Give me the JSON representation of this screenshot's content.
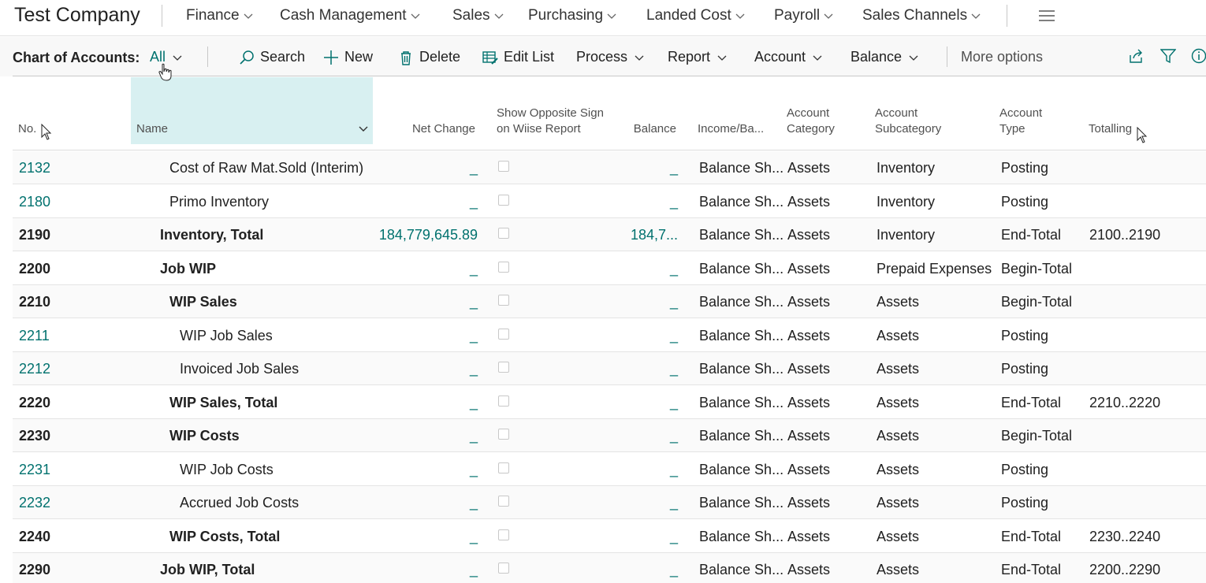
{
  "app": {
    "company": "Test Company",
    "nav": [
      "Finance",
      "Cash Management",
      "Sales",
      "Purchasing",
      "Landed Cost",
      "Payroll",
      "Sales Channels"
    ]
  },
  "actionbar": {
    "title": "Chart of Accounts:",
    "view": "All",
    "search": "Search",
    "new": "New",
    "delete": "Delete",
    "edit_list": "Edit List",
    "process": "Process",
    "report": "Report",
    "account": "Account",
    "balance": "Balance",
    "more_options": "More options"
  },
  "columns": {
    "no": "No.",
    "name": "Name",
    "net_change": "Net Change",
    "opp_sign_1": "Show Opposite Sign",
    "opp_sign_2": "on Wiise Report",
    "balance": "Balance",
    "income_balance": "Income/Ba...",
    "category_1": "Account",
    "category_2": "Category",
    "subcategory_1": "Account",
    "subcategory_2": "Subcategory",
    "type_1": "Account",
    "type_2": "Type",
    "totalling": "Totalling"
  },
  "rows": [
    {
      "no": "2132",
      "name": "Cost of Raw Mat.Sold (Interim)",
      "indent": 2,
      "bold": false,
      "net_change": "_",
      "balance": "_",
      "ib": "Balance Sh...",
      "cat": "Assets",
      "subcat": "Inventory",
      "type": "Posting",
      "totalling": ""
    },
    {
      "no": "2180",
      "name": "Primo Inventory",
      "indent": 2,
      "bold": false,
      "net_change": "_",
      "balance": "_",
      "ib": "Balance Sh...",
      "cat": "Assets",
      "subcat": "Inventory",
      "type": "Posting",
      "totalling": ""
    },
    {
      "no": "2190",
      "name": "Inventory, Total",
      "indent": 1,
      "bold": true,
      "net_change": "184,779,645.89",
      "balance": "184,7...",
      "ib": "Balance Sh...",
      "cat": "Assets",
      "subcat": "Inventory",
      "type": "End-Total",
      "totalling": "2100..2190"
    },
    {
      "no": "2200",
      "name": "Job WIP",
      "indent": 1,
      "bold": true,
      "net_change": "_",
      "balance": "_",
      "ib": "Balance Sh...",
      "cat": "Assets",
      "subcat": "Prepaid Expenses",
      "type": "Begin-Total",
      "totalling": ""
    },
    {
      "no": "2210",
      "name": "WIP Sales",
      "indent": 2,
      "bold": true,
      "net_change": "_",
      "balance": "_",
      "ib": "Balance Sh...",
      "cat": "Assets",
      "subcat": "Assets",
      "type": "Begin-Total",
      "totalling": ""
    },
    {
      "no": "2211",
      "name": "WIP Job Sales",
      "indent": 3,
      "bold": false,
      "net_change": "_",
      "balance": "_",
      "ib": "Balance Sh...",
      "cat": "Assets",
      "subcat": "Assets",
      "type": "Posting",
      "totalling": ""
    },
    {
      "no": "2212",
      "name": "Invoiced Job Sales",
      "indent": 3,
      "bold": false,
      "net_change": "_",
      "balance": "_",
      "ib": "Balance Sh...",
      "cat": "Assets",
      "subcat": "Assets",
      "type": "Posting",
      "totalling": ""
    },
    {
      "no": "2220",
      "name": "WIP Sales, Total",
      "indent": 2,
      "bold": true,
      "net_change": "_",
      "balance": "_",
      "ib": "Balance Sh...",
      "cat": "Assets",
      "subcat": "Assets",
      "type": "End-Total",
      "totalling": "2210..2220"
    },
    {
      "no": "2230",
      "name": "WIP Costs",
      "indent": 2,
      "bold": true,
      "net_change": "_",
      "balance": "_",
      "ib": "Balance Sh...",
      "cat": "Assets",
      "subcat": "Assets",
      "type": "Begin-Total",
      "totalling": ""
    },
    {
      "no": "2231",
      "name": "WIP Job Costs",
      "indent": 3,
      "bold": false,
      "net_change": "_",
      "balance": "_",
      "ib": "Balance Sh...",
      "cat": "Assets",
      "subcat": "Assets",
      "type": "Posting",
      "totalling": ""
    },
    {
      "no": "2232",
      "name": "Accrued Job Costs",
      "indent": 3,
      "bold": false,
      "net_change": "_",
      "balance": "_",
      "ib": "Balance Sh...",
      "cat": "Assets",
      "subcat": "Assets",
      "type": "Posting",
      "totalling": ""
    },
    {
      "no": "2240",
      "name": "WIP Costs, Total",
      "indent": 2,
      "bold": true,
      "net_change": "_",
      "balance": "_",
      "ib": "Balance Sh...",
      "cat": "Assets",
      "subcat": "Assets",
      "type": "End-Total",
      "totalling": "2230..2240"
    },
    {
      "no": "2290",
      "name": "Job WIP, Total",
      "indent": 1,
      "bold": true,
      "net_change": "_",
      "balance": "_",
      "ib": "Balance Sh...",
      "cat": "Assets",
      "subcat": "Assets",
      "type": "End-Total",
      "totalling": "2200..2290"
    }
  ],
  "colors": {
    "accent": "#00716e",
    "name_header_bg": "#d8f0f1",
    "border": "#c8c8c8"
  },
  "icons": [
    "chevron-down-icon",
    "hamburger-icon",
    "search-icon",
    "plus-icon",
    "trash-icon",
    "edit-list-icon",
    "share-icon",
    "filter-icon",
    "info-icon"
  ]
}
